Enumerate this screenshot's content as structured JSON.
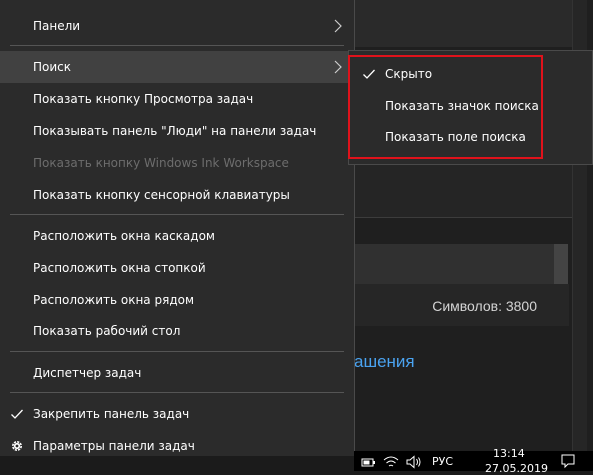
{
  "background": {
    "counter_text": "Символов: 3800",
    "link_text": "ашения"
  },
  "menu": {
    "items": [
      {
        "label": "Панели",
        "has_submenu": true,
        "highlighted": false,
        "disabled": false,
        "checked": false
      },
      {
        "label": "Поиск",
        "has_submenu": true,
        "highlighted": true,
        "disabled": false,
        "checked": false
      },
      {
        "label": "Показать кнопку Просмотра задач",
        "has_submenu": false,
        "highlighted": false,
        "disabled": false,
        "checked": false
      },
      {
        "label": "Показывать панель \"Люди\" на панели задач",
        "has_submenu": false,
        "highlighted": false,
        "disabled": false,
        "checked": false
      },
      {
        "label": "Показать кнопку Windows Ink Workspace",
        "has_submenu": false,
        "highlighted": false,
        "disabled": true,
        "checked": false
      },
      {
        "label": "Показать кнопку сенсорной клавиатуры",
        "has_submenu": false,
        "highlighted": false,
        "disabled": false,
        "checked": false
      },
      {
        "label": "Расположить окна каскадом",
        "has_submenu": false,
        "highlighted": false,
        "disabled": false,
        "checked": false
      },
      {
        "label": "Расположить окна стопкой",
        "has_submenu": false,
        "highlighted": false,
        "disabled": false,
        "checked": false
      },
      {
        "label": "Расположить окна рядом",
        "has_submenu": false,
        "highlighted": false,
        "disabled": false,
        "checked": false
      },
      {
        "label": "Показать рабочий стол",
        "has_submenu": false,
        "highlighted": false,
        "disabled": false,
        "checked": false
      },
      {
        "label": "Диспетчер задач",
        "has_submenu": false,
        "highlighted": false,
        "disabled": false,
        "checked": false
      },
      {
        "label": "Закрепить панель задач",
        "has_submenu": false,
        "highlighted": false,
        "disabled": false,
        "checked": true,
        "icon": "checkmark-icon"
      },
      {
        "label": "Параметры панели задач",
        "has_submenu": false,
        "highlighted": false,
        "disabled": false,
        "checked": false,
        "icon": "gear-icon"
      }
    ]
  },
  "submenu": {
    "title": "Поиск",
    "items": [
      {
        "label": "Скрыто",
        "checked": true
      },
      {
        "label": "Показать значок поиска",
        "checked": false
      },
      {
        "label": "Показать поле поиска",
        "checked": false
      }
    ],
    "highlight_color": "#e0121b"
  },
  "taskbar": {
    "language": "РУС",
    "time": "13:14",
    "date": "27.05.2019",
    "tray_icons": [
      "battery-icon",
      "network-icon",
      "volume-icon",
      "notification-icon"
    ]
  },
  "colors": {
    "menu_background": "#2b2b2b",
    "menu_highlight": "#414141",
    "text": "#ffffff",
    "disabled_text": "#6d6d6d",
    "link": "#4aa3f0"
  }
}
